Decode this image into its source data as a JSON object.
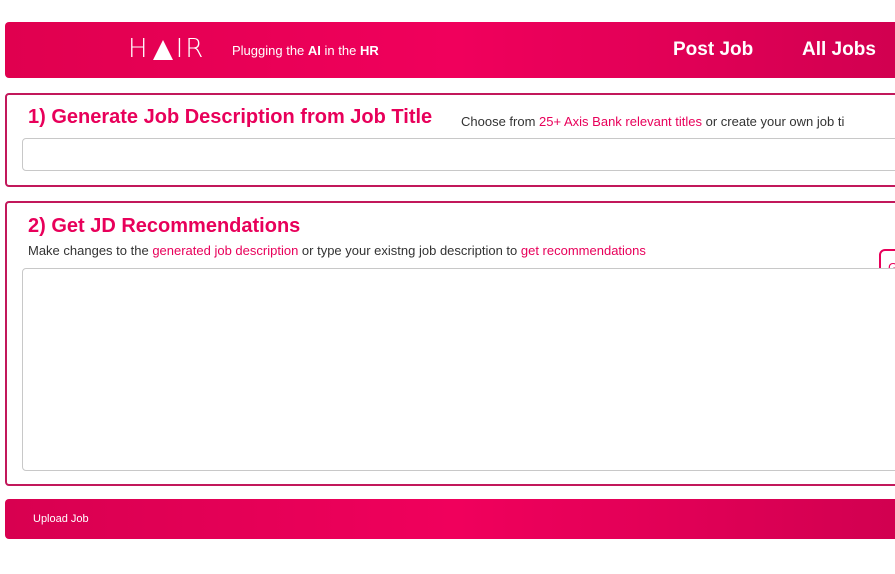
{
  "header": {
    "logo_left": "H",
    "logo_right": "IR",
    "tagline_pre": "Plugging the ",
    "tagline_ai": "AI",
    "tagline_mid": " in the ",
    "tagline_hr": "HR",
    "nav": {
      "post_job": "Post Job",
      "all_jobs": "All Jobs"
    }
  },
  "section1": {
    "title": "1) Generate Job Description from Job Title",
    "hint_pre": "Choose from ",
    "hint_link": "25+ Axis Bank relevant titles",
    "hint_post": " or create your own job ti",
    "input_value": ""
  },
  "section2": {
    "title": "2) Get JD Recommendations",
    "hint_pre": "Make changes to the ",
    "hint_link1": "generated job description",
    "hint_mid": " or type your existng job description to ",
    "hint_link2": "get recommendations",
    "button_label": "G",
    "textarea_value": ""
  },
  "footer": {
    "upload_label": "Upload Job"
  },
  "colors": {
    "brand": "#e8005a",
    "border": "#c2185b"
  }
}
